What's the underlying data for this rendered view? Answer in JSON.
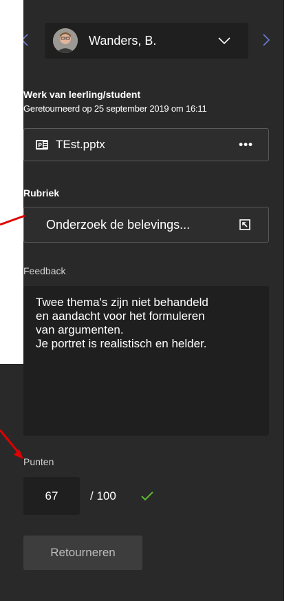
{
  "header": {
    "student_name": "Wanders, B.",
    "prev_icon": "chevron-left-icon",
    "next_icon": "chevron-right-icon",
    "dropdown_icon": "chevron-down-icon"
  },
  "work": {
    "title": "Werk van leerling/student",
    "returned_text": "Geretourneerd op 25 september 2019 om 16:11",
    "file_name": "TEst.pptx",
    "more_label": "•••"
  },
  "rubric": {
    "title": "Rubriek",
    "button_label": "Onderzoek de belevings..."
  },
  "feedback": {
    "title": "Feedback",
    "text": "Twee thema's zijn niet behandeld\nen aandacht voor het formuleren\nvan argumenten.\nJe portret is realistisch en helder."
  },
  "points": {
    "title": "Punten",
    "value": "67",
    "max_label": "/ 100"
  },
  "actions": {
    "return_label": "Retourneren"
  },
  "colors": {
    "panel_bg": "#292929",
    "input_bg": "#1f1f1f",
    "check_green": "#5fb832",
    "annotation_red": "#e00000"
  }
}
